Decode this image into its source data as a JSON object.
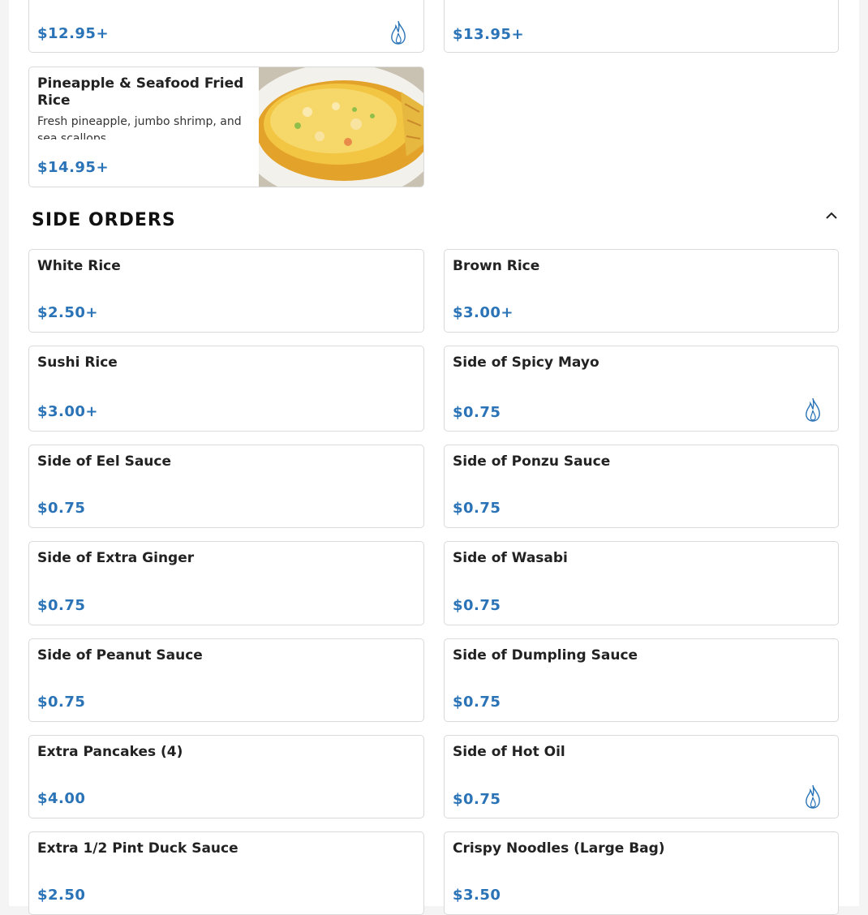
{
  "top_cards": [
    {
      "price": "$12.95+",
      "spicy": true
    },
    {
      "price": "$13.95+",
      "spicy": false
    }
  ],
  "featured": {
    "name": "Pineapple & Seafood Fried Rice",
    "description": "Fresh pineapple, jumbo shrimp, and sea scallops",
    "price": "$14.95+"
  },
  "section": {
    "title": "SIDE ORDERS",
    "collapse_icon": "chevron-up-icon"
  },
  "side_orders": [
    {
      "name": "White Rice",
      "price": "$2.50+",
      "spicy": false
    },
    {
      "name": "Brown Rice",
      "price": "$3.00+",
      "spicy": false
    },
    {
      "name": "Sushi Rice",
      "price": "$3.00+",
      "spicy": false
    },
    {
      "name": "Side of Spicy Mayo",
      "price": "$0.75",
      "spicy": true
    },
    {
      "name": "Side of Eel Sauce",
      "price": "$0.75",
      "spicy": false
    },
    {
      "name": "Side of Ponzu Sauce",
      "price": "$0.75",
      "spicy": false
    },
    {
      "name": "Side of Extra Ginger",
      "price": "$0.75",
      "spicy": false
    },
    {
      "name": "Side of Wasabi",
      "price": "$0.75",
      "spicy": false
    },
    {
      "name": "Side of Peanut Sauce",
      "price": "$0.75",
      "spicy": false
    },
    {
      "name": "Side of Dumpling Sauce",
      "price": "$0.75",
      "spicy": false
    },
    {
      "name": "Extra Pancakes (4)",
      "price": "$4.00",
      "spicy": false
    },
    {
      "name": "Side of Hot Oil",
      "price": "$0.75",
      "spicy": true
    },
    {
      "name": "Extra 1/2 Pint Duck Sauce",
      "price": "$2.50",
      "spicy": false
    },
    {
      "name": "Crispy Noodles (Large Bag)",
      "price": "$3.50",
      "spicy": false
    }
  ],
  "colors": {
    "price": "#2a73b7",
    "spicy_icon": "#2a73b7",
    "border": "#d9d9d9"
  }
}
